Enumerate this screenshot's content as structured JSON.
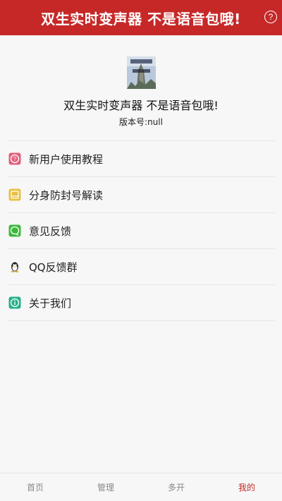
{
  "header": {
    "title": "双生实时变声器 不是语音包哦!",
    "help_icon": "question-circle-icon",
    "help_glyph": "?",
    "color": "#c62828"
  },
  "profile": {
    "app_name": "双生实时变声器 不是语音包哦!",
    "version_label": "版本号:",
    "version_value": "null"
  },
  "menu": {
    "items": [
      {
        "label": "新用户使用教程",
        "icon": "question-square-icon",
        "color": "#e0607e"
      },
      {
        "label": "分身防封号解读",
        "icon": "book-icon",
        "color": "#e8c040"
      },
      {
        "label": "意见反馈",
        "icon": "chat-bubble-icon",
        "color": "#3db83d"
      },
      {
        "label": "QQ反馈群",
        "icon": "qq-penguin-icon",
        "color": "#222222"
      },
      {
        "label": "关于我们",
        "icon": "info-icon",
        "color": "#26b08a"
      }
    ]
  },
  "tabbar": {
    "tabs": [
      {
        "label": "首页",
        "active": false
      },
      {
        "label": "管理",
        "active": false
      },
      {
        "label": "多开",
        "active": false
      },
      {
        "label": "我的",
        "active": true
      }
    ],
    "active_color": "#c62828"
  }
}
